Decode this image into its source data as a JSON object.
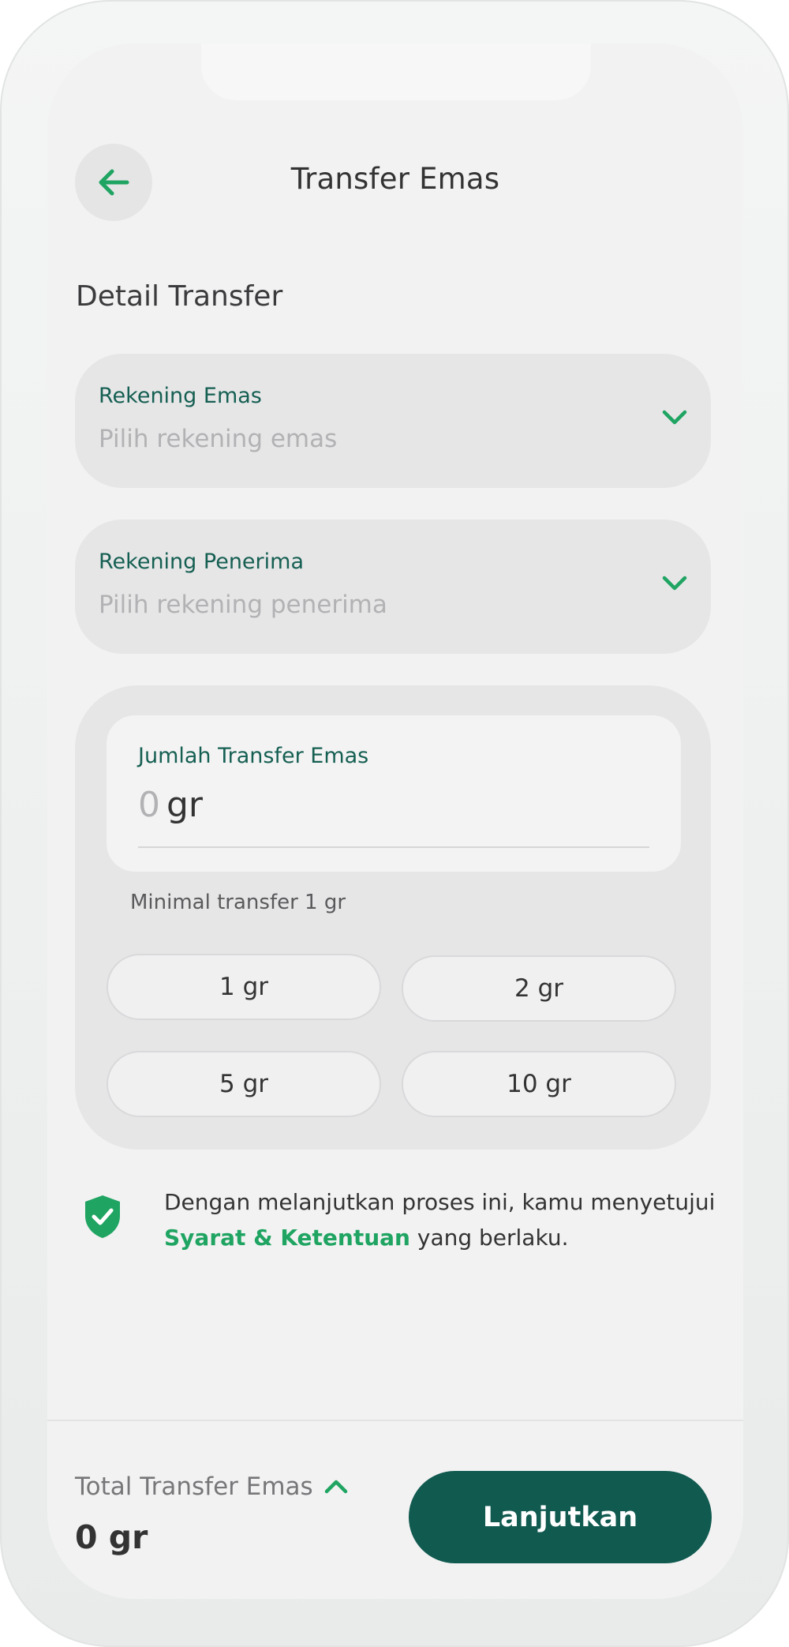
{
  "header": {
    "title": "Transfer Emas",
    "back_icon": "arrow-left-icon"
  },
  "section": {
    "title": "Detail Transfer"
  },
  "source_account": {
    "label": "Rekening Emas",
    "placeholder": "Pilih rekening emas",
    "icon": "chevron-down-icon"
  },
  "recipient_account": {
    "label": "Rekening Penerima",
    "placeholder": "Pilih rekening penerima",
    "icon": "chevron-down-icon"
  },
  "amount": {
    "label": "Jumlah Transfer Emas",
    "value": "0",
    "unit": "gr",
    "min_note": "Minimal transfer 1 gr",
    "quick_options": [
      "1 gr",
      "2 gr",
      "5 gr",
      "10 gr"
    ]
  },
  "terms": {
    "text_before": "Dengan melanjutkan proses ini, kamu menyetujui ",
    "link": "Syarat & Ketentuan",
    "text_after": " yang berlaku.",
    "icon": "shield-check-icon"
  },
  "footer": {
    "total_label": "Total Transfer Emas",
    "total_value": "0 gr",
    "toggle_icon": "chevron-up-icon",
    "cta_label": "Lanjutkan"
  },
  "colors": {
    "accent_green": "#1fa462",
    "primary_dark_green": "#105a50",
    "label_green": "#155f52"
  }
}
